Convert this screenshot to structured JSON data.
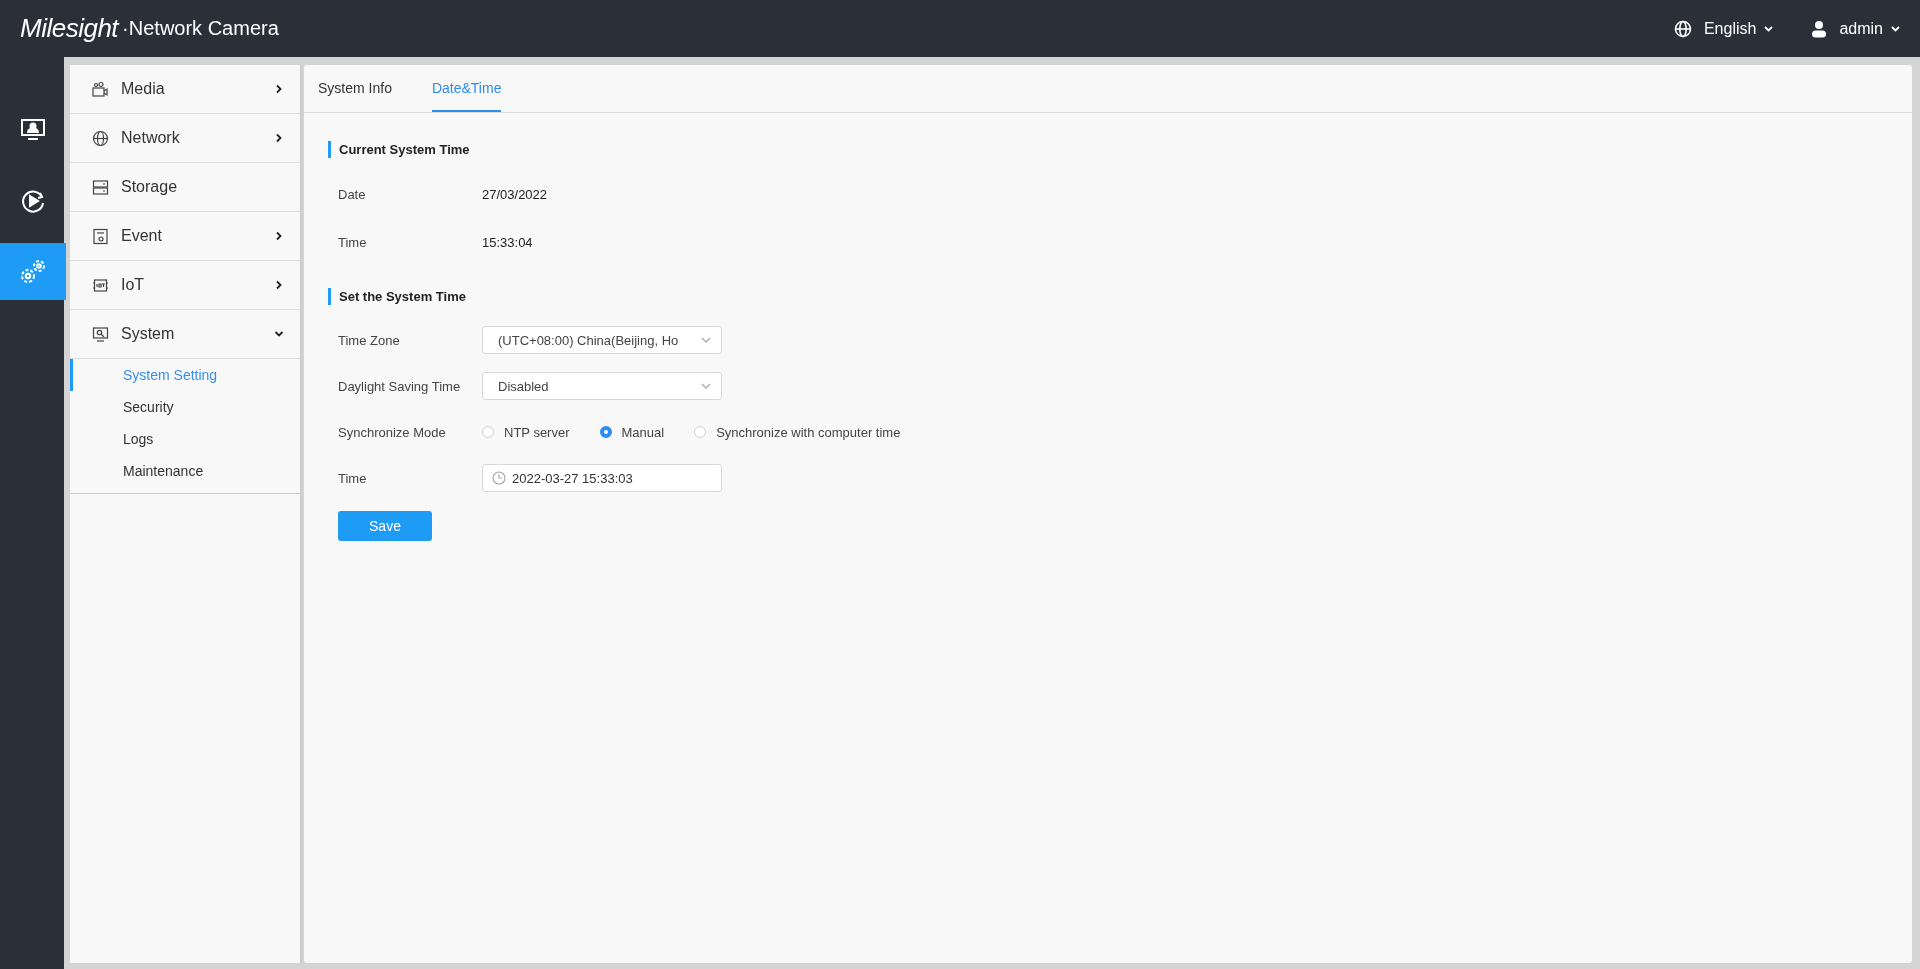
{
  "top_bar": {
    "logo": "Milesight",
    "title": "·Network Camera",
    "language": "English",
    "user": "admin"
  },
  "rail": [
    {
      "kind": "live",
      "selected": false
    },
    {
      "kind": "playback",
      "selected": false
    },
    {
      "kind": "settings",
      "selected": true
    }
  ],
  "menu": [
    {
      "label": "Media",
      "kind": "media",
      "expanded": false
    },
    {
      "label": "Network",
      "kind": "network",
      "expanded": false
    },
    {
      "label": "Storage",
      "kind": "storage"
    },
    {
      "label": "Event",
      "kind": "event",
      "expanded": false
    },
    {
      "label": "IoT",
      "kind": "iot",
      "expanded": false
    },
    {
      "label": "System",
      "kind": "system",
      "expanded": true,
      "children": [
        {
          "label": "System Setting",
          "selected": true
        },
        {
          "label": "Security",
          "selected": false
        },
        {
          "label": "Logs",
          "selected": false
        },
        {
          "label": "Maintenance",
          "selected": false
        }
      ]
    }
  ],
  "tabs": [
    {
      "label": "System Info",
      "selected": false
    },
    {
      "label": "Date&Time",
      "selected": true
    }
  ],
  "sections": [
    {
      "title": "Current System Time",
      "fields": [
        {
          "kind": "text",
          "label": "Date",
          "value": "27/03/2022"
        },
        {
          "kind": "text",
          "label": "Time",
          "value": "15:33:04"
        }
      ]
    },
    {
      "title": "Set the System Time",
      "fields": [
        {
          "kind": "select",
          "label": "Time Zone",
          "value": "(UTC+08:00) China(Beijing, Ho"
        },
        {
          "kind": "select",
          "label": "Daylight Saving Time",
          "value": "Disabled"
        },
        {
          "kind": "radio",
          "label": "Synchronize Mode",
          "options": [
            {
              "label": "NTP server",
              "selected": false
            },
            {
              "label": "Manual",
              "selected": true
            },
            {
              "label": "Synchronize with computer time",
              "selected": false
            }
          ]
        },
        {
          "kind": "datetime",
          "label": "Time",
          "value": "2022-03-27 15:33:03"
        }
      ]
    }
  ],
  "save_button": "Save"
}
